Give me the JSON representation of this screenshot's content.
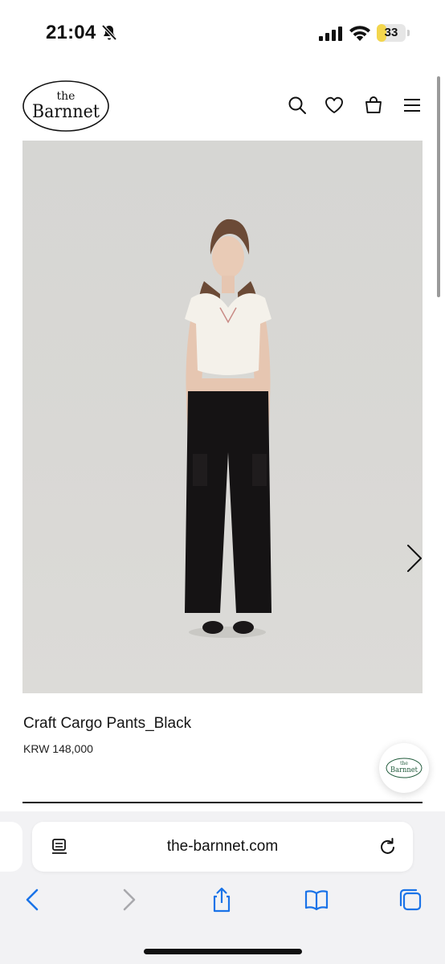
{
  "status_bar": {
    "time": "21:04",
    "battery_level": "33",
    "battery_fraction": 0.33,
    "icons": [
      "bell-slash-icon",
      "cellular-signal-icon",
      "wifi-icon",
      "battery-icon"
    ],
    "battery_color": "#f3d64d"
  },
  "header": {
    "logo_line1": "the",
    "logo_line2": "Barnnet",
    "icons": [
      "search-icon",
      "heart-icon",
      "shopping-bag-icon",
      "menu-icon"
    ]
  },
  "product": {
    "name": "Craft Cargo Pants_Black",
    "price": "KRW 148,000",
    "image_icons": [
      "chevron-right-icon"
    ]
  },
  "chat_badge": {
    "line1": "the",
    "line2": "Barnnet",
    "accent_color": "#1f5a3a"
  },
  "browser": {
    "url": "the-barnnet.com",
    "icons": [
      "reader-icon",
      "reload-icon",
      "back-icon",
      "forward-icon",
      "share-icon",
      "bookmarks-icon",
      "tabs-icon"
    ],
    "accent_color": "#1a73e8"
  }
}
